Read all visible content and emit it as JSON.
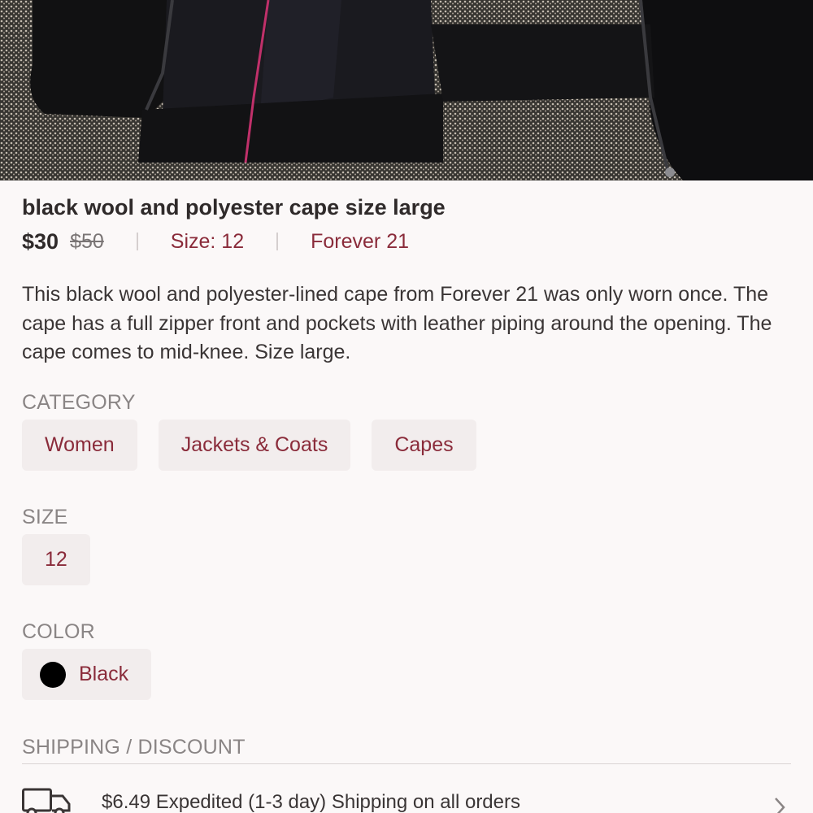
{
  "listing": {
    "title": "black wool and polyester cape size large",
    "price": "$30",
    "original_price": "$50",
    "size_link": "Size: 12",
    "brand_link": "Forever 21",
    "description": "This black wool and polyester-lined cape from Forever 21 was only worn once. The cape has a full zipper front and pockets with leather piping around the opening. The cape comes to mid-knee. Size large."
  },
  "category": {
    "label": "CATEGORY",
    "chips": [
      "Women",
      "Jackets & Coats",
      "Capes"
    ]
  },
  "size": {
    "label": "SIZE",
    "chips": [
      "12"
    ]
  },
  "color": {
    "label": "COLOR",
    "name": "Black",
    "swatch_hex": "#000000"
  },
  "shipping": {
    "label": "SHIPPING / DISCOUNT",
    "text": "$6.49 Expedited (1-3 day) Shipping on all orders",
    "icon": "truck-icon"
  },
  "colors": {
    "accent": "#8a2b3a",
    "background": "#fbf8f8",
    "chip_background": "#f2eded"
  }
}
